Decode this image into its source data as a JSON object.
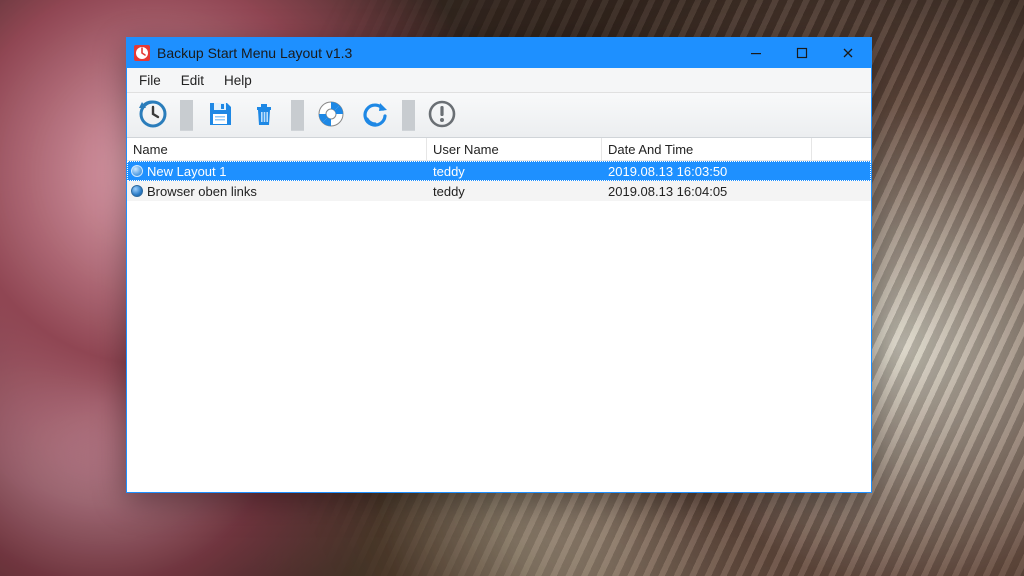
{
  "window": {
    "title": "Backup Start Menu Layout v1.3"
  },
  "menu": {
    "file": "File",
    "edit": "Edit",
    "help": "Help"
  },
  "columns": {
    "name": "Name",
    "user": "User Name",
    "date": "Date And Time"
  },
  "rows": [
    {
      "name": "New Layout 1",
      "user": "teddy",
      "date": "2019.08.13 16:03:50",
      "selected": true
    },
    {
      "name": "Browser oben links",
      "user": "teddy",
      "date": "2019.08.13 16:04:05",
      "selected": false
    }
  ],
  "icons": {
    "backup": "backup-clock-icon",
    "save": "floppy-save-icon",
    "delete": "trash-icon",
    "help": "lifebuoy-icon",
    "refresh": "refresh-icon",
    "about": "exclamation-icon"
  }
}
